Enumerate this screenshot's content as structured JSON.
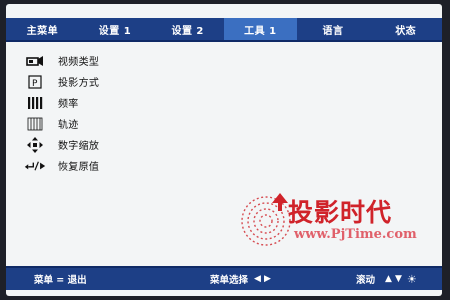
{
  "tabs": [
    {
      "label": "主菜单"
    },
    {
      "label": "设置 1"
    },
    {
      "label": "设置 2"
    },
    {
      "label": "工具 1",
      "active": true
    },
    {
      "label": "语言"
    },
    {
      "label": "状态"
    }
  ],
  "menu": {
    "items": [
      {
        "label": "视频类型",
        "icon": "projector-icon"
      },
      {
        "label": "投影方式",
        "icon": "projection-mode-icon"
      },
      {
        "label": "频率",
        "icon": "frequency-icon"
      },
      {
        "label": "轨迹",
        "icon": "tracking-icon"
      },
      {
        "label": "数字缩放",
        "icon": "digital-zoom-icon"
      },
      {
        "label": "恢复原值",
        "icon": "reset-icon"
      }
    ]
  },
  "watermark": {
    "name": "投影时代",
    "url": "www.PjTime.com"
  },
  "footer": {
    "exit_label": "菜单 = 退出",
    "select_label": "菜单选择",
    "scroll_label": "滚动"
  },
  "colors": {
    "bar": "#1d3f86",
    "active_tab": "#3b6fc1",
    "panel": "#f3f5f6",
    "watermark": "#d0232a"
  }
}
